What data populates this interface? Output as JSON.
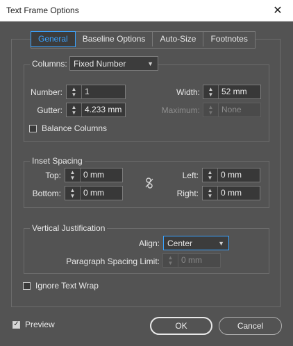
{
  "window": {
    "title": "Text Frame Options",
    "close_glyph": "✕"
  },
  "tabs": [
    {
      "label": "General",
      "active": true
    },
    {
      "label": "Baseline Options",
      "active": false
    },
    {
      "label": "Auto-Size",
      "active": false
    },
    {
      "label": "Footnotes",
      "active": false
    }
  ],
  "columns": {
    "label": "Columns:",
    "type_value": "Fixed Number",
    "number_label": "Number:",
    "number_value": "1",
    "gutter_label": "Gutter:",
    "gutter_value": "4.233 mm",
    "width_label": "Width:",
    "width_value": "52 mm",
    "maximum_label": "Maximum:",
    "maximum_value": "None",
    "balance_label": "Balance Columns",
    "balance_checked": false
  },
  "inset": {
    "legend": "Inset Spacing",
    "top_label": "Top:",
    "top_value": "0 mm",
    "bottom_label": "Bottom:",
    "bottom_value": "0 mm",
    "left_label": "Left:",
    "left_value": "0 mm",
    "right_label": "Right:",
    "right_value": "0 mm",
    "link_icon": "chain-broken-icon"
  },
  "vertical": {
    "legend": "Vertical Justification",
    "align_label": "Align:",
    "align_value": "Center",
    "psl_label": "Paragraph Spacing Limit:",
    "psl_value": "0 mm"
  },
  "ignore_wrap": {
    "label": "Ignore Text Wrap",
    "checked": false
  },
  "preview": {
    "label": "Preview",
    "checked": true
  },
  "buttons": {
    "ok": "OK",
    "cancel": "Cancel"
  },
  "colors": {
    "background": "#535353",
    "accent": "#3aa3ff",
    "field": "#383838"
  }
}
